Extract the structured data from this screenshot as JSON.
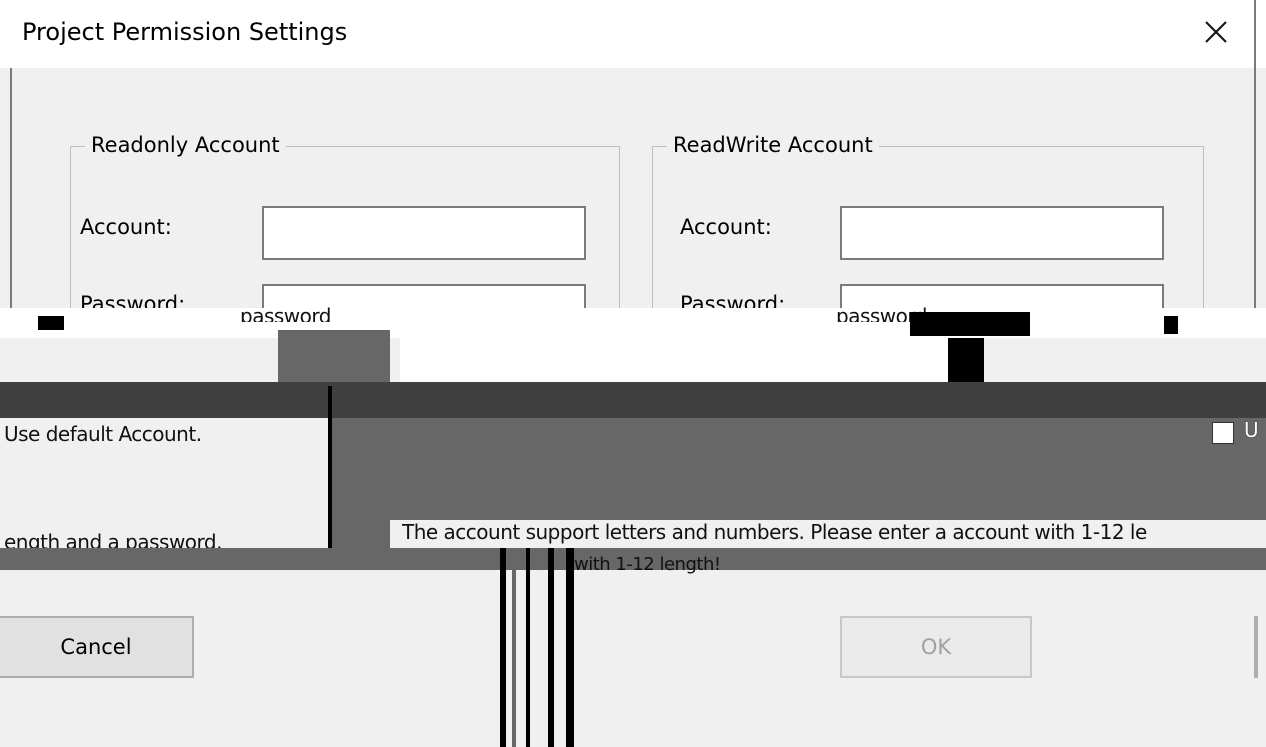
{
  "dialog": {
    "title": "Project Permission Settings",
    "close_symbol": "✕"
  },
  "readonly": {
    "group_title": "Readonly Account",
    "account_label": "Account:",
    "account_value": "",
    "password_label": "Password:",
    "password_placeholder": "password"
  },
  "readwrite": {
    "group_title": "ReadWrite Account",
    "account_label": "Account:",
    "account_value": "",
    "password_label": "Password:",
    "password_placeholder": "password"
  },
  "default_account": {
    "label_fragment": "Use default Account.",
    "checkbox_label_fragment": "U",
    "checked": false
  },
  "hints": {
    "left_fragment": "ength and a password.",
    "main": "The account support letters and numbers. Please enter a account with 1-12 le",
    "second_line": "with 1-12 length!"
  },
  "buttons": {
    "cancel": "Cancel",
    "ok": "OK"
  }
}
